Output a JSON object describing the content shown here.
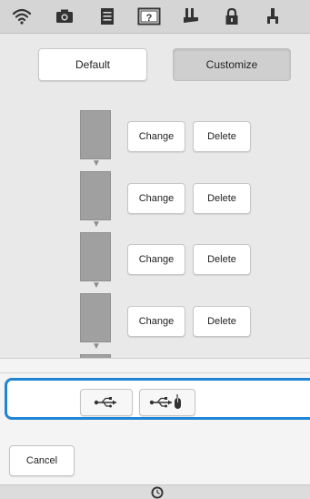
{
  "toolbar": {
    "icons": [
      "wifi-icon",
      "camera-icon",
      "document-icon",
      "help-icon",
      "boot-icon",
      "lock-icon",
      "presser-foot-icon"
    ]
  },
  "mode": {
    "default_label": "Default",
    "customize_label": "Customize",
    "selected": "Customize"
  },
  "sequence": {
    "items": [
      {
        "change_label": "Change",
        "delete_label": "Delete"
      },
      {
        "change_label": "Change",
        "delete_label": "Delete"
      },
      {
        "change_label": "Change",
        "delete_label": "Delete"
      },
      {
        "change_label": "Change",
        "delete_label": "Delete"
      }
    ]
  },
  "popup": {
    "usb_options": [
      "usb-icon",
      "usb-mouse-icon"
    ],
    "cancel_label": "Cancel",
    "accent_color": "#1f86d6"
  }
}
